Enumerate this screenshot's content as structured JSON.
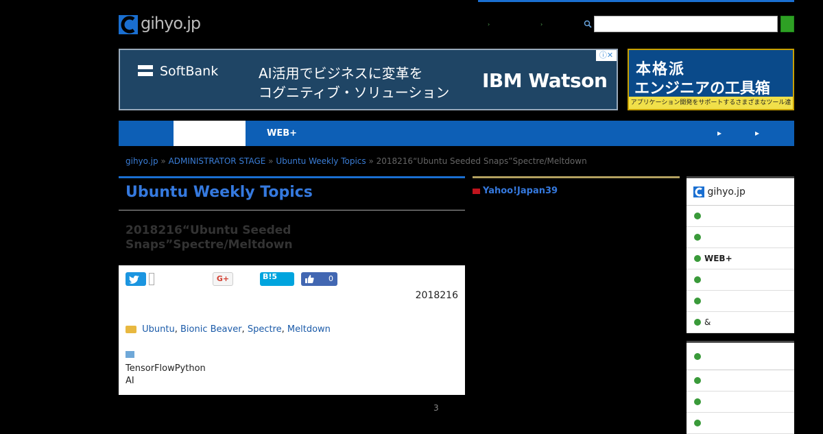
{
  "site": {
    "logo_text": "gihyo.jp",
    "header_links": [
      "",
      ""
    ],
    "search": {
      "placeholder": ""
    }
  },
  "banner_ad": {
    "brand": "SoftBank",
    "headline_line1": "AI活用でビジネスに変革を",
    "headline_line2": "コグニティブ・ソリューション",
    "product": "IBM Watson"
  },
  "side_ad": {
    "line1": "本格派",
    "line2": "エンジニアの工具箱",
    "line3": "アプリケーション開発をサポートするさまざまなツール達"
  },
  "nav": {
    "items": [
      {
        "label": "",
        "active": false
      },
      {
        "label": "",
        "active": true
      },
      {
        "label": "WEB+",
        "active": false
      },
      {
        "label": "",
        "active": false
      }
    ],
    "right": [
      "",
      ""
    ]
  },
  "breadcrumb": {
    "home": "gihyo.jp",
    "sep": "»",
    "section": "ADMINISTRATOR STAGE",
    "series": "Ubuntu Weekly Topics",
    "current": "2018216“Ubuntu Seeded Snaps”Spectre/Meltdown"
  },
  "article": {
    "series_title": "Ubuntu Weekly Topics",
    "title": "2018216“Ubuntu Seeded Snaps”Spectre/Meltdown",
    "share": {
      "tweet_count": "",
      "gplus": "G+",
      "hatena": "B!5",
      "facebook_count": "0"
    },
    "date": "2018216",
    "tags": [
      "Ubuntu",
      "Bionic Beaver",
      "Spectre",
      "Meltdown"
    ],
    "related": [
      "TensorFlowPython",
      "AI"
    ],
    "page_count": "3"
  },
  "news": {
    "text": "Yahoo!Japan39"
  },
  "sidebar": {
    "box1_logo": "gihyo.jp",
    "box1_items": [
      "",
      "",
      "WEB+",
      "",
      "",
      "&"
    ],
    "box2_title": "",
    "box2_items": [
      "",
      "",
      ""
    ]
  },
  "colors": {
    "accent_blue": "#0d5fb6",
    "link_blue": "#3579de",
    "green": "#2ea024",
    "gold": "#b3a160"
  }
}
